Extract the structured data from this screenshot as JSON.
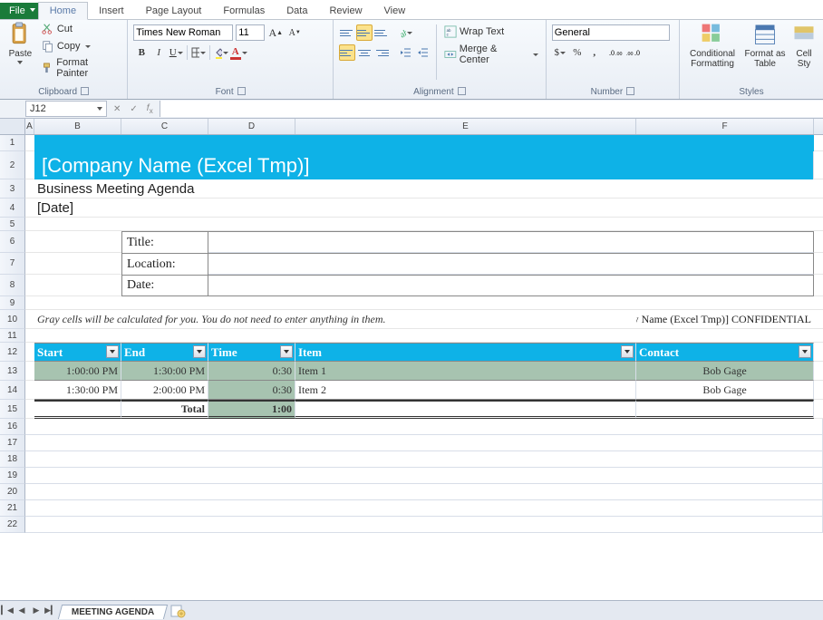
{
  "tabs": {
    "file": "File",
    "items": [
      "Home",
      "Insert",
      "Page Layout",
      "Formulas",
      "Data",
      "Review",
      "View"
    ],
    "active": "Home"
  },
  "ribbon": {
    "clipboard": {
      "label": "Clipboard",
      "paste": "Paste",
      "cut": "Cut",
      "copy": "Copy",
      "fmtpainter": "Format Painter"
    },
    "font": {
      "label": "Font",
      "name": "Times New Roman",
      "size": "11"
    },
    "alignment": {
      "label": "Alignment",
      "wrap": "Wrap Text",
      "merge": "Merge & Center"
    },
    "number": {
      "label": "Number",
      "format": "General"
    },
    "styles": {
      "label": "Styles",
      "cond": "Conditional Formatting",
      "fmt": "Format as Table",
      "cell": "Cell Sty"
    }
  },
  "formula": {
    "namebox": "J12",
    "fx": ""
  },
  "cols": [
    "A",
    "B",
    "C",
    "D",
    "E",
    "F"
  ],
  "rows": [
    "1",
    "2",
    "3",
    "4",
    "5",
    "6",
    "7",
    "8",
    "9",
    "10",
    "11",
    "12",
    "13",
    "14",
    "15",
    "16",
    "17",
    "18",
    "19",
    "20",
    "21",
    "22"
  ],
  "sheet": {
    "company": "[Company Name (Excel Tmp)]",
    "subtitle": "Business Meeting Agenda",
    "date": "[Date]",
    "labels": {
      "title": "Title:",
      "location": "Location:",
      "dt": "Date:"
    },
    "note": "Gray cells will be calculated for you. You do not need to enter anything in them.",
    "confidential": "[Company Name (Excel Tmp)] CONFIDENTIAL",
    "headers": {
      "start": "Start",
      "end": "End",
      "time": "Time",
      "item": "Item",
      "contact": "Contact"
    },
    "data": [
      {
        "start": "1:00:00 PM",
        "end": "1:30:00 PM",
        "time": "0:30",
        "item": "Item 1",
        "contact": "Bob Gage"
      },
      {
        "start": "1:30:00 PM",
        "end": "2:00:00 PM",
        "time": "0:30",
        "item": "Item 2",
        "contact": "Bob Gage"
      }
    ],
    "total_label": "Total",
    "total_time": "1:00"
  },
  "chart_data": {
    "type": "table",
    "title": "Business Meeting Agenda",
    "columns": [
      "Start",
      "End",
      "Time",
      "Item",
      "Contact"
    ],
    "rows": [
      [
        "1:00:00 PM",
        "1:30:00 PM",
        "0:30",
        "Item 1",
        "Bob Gage"
      ],
      [
        "1:30:00 PM",
        "2:00:00 PM",
        "0:30",
        "Item 2",
        "Bob Gage"
      ]
    ],
    "totals": {
      "Time": "1:00"
    }
  },
  "sheettab": {
    "name": "MEETING AGENDA"
  }
}
